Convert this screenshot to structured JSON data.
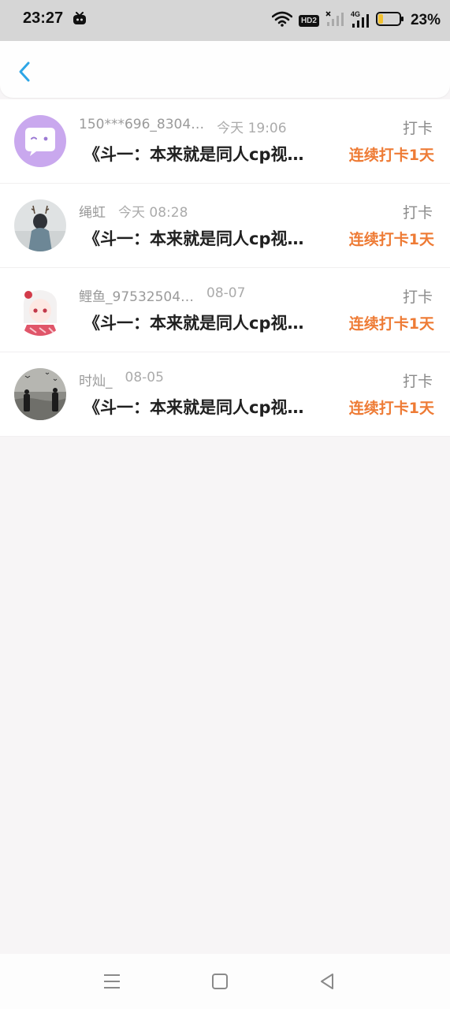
{
  "status_bar": {
    "time": "23:27",
    "battery_percent": "23%",
    "network_badge": "HD2",
    "network_type": "4G",
    "battery_level": 0.23,
    "battery_color": "#f2c12e",
    "icons": [
      "tv-app-icon",
      "wifi-icon",
      "hd-badge-icon",
      "signal-no-service-icon",
      "signal-4g-icon",
      "battery-icon"
    ]
  },
  "header": {
    "back_icon": "chevron-left-icon",
    "accent_color": "#2ea6e6"
  },
  "list": {
    "items": [
      {
        "user": "150***696_8304…",
        "time": "今天 19:06",
        "title": "《斗一：本来就是同人cp视…",
        "action": "打卡",
        "streak": "连续打卡1天",
        "avatar": "chat-bubble-avatar"
      },
      {
        "user": "绳虹",
        "time": "今天 08:28",
        "title": "《斗一：本来就是同人cp视…",
        "action": "打卡",
        "streak": "连续打卡1天",
        "avatar": "antler-girl-avatar"
      },
      {
        "user": "鲤鱼_97532504…",
        "time": "08-07",
        "title": "《斗一：本来就是同人cp视…",
        "action": "打卡",
        "streak": "连续打卡1天",
        "avatar": "anime-girl-avatar"
      },
      {
        "user": "时灿_",
        "time": "08-05",
        "title": "《斗一：本来就是同人cp视…",
        "action": "打卡",
        "streak": "连续打卡1天",
        "avatar": "beach-couple-avatar"
      }
    ]
  },
  "colors": {
    "streak": "#ee7b35",
    "meta": "#9a9a9a",
    "title": "#202020"
  },
  "nav_bar": {
    "icons": [
      "menu-icon",
      "home-icon",
      "back-triangle-icon"
    ]
  }
}
